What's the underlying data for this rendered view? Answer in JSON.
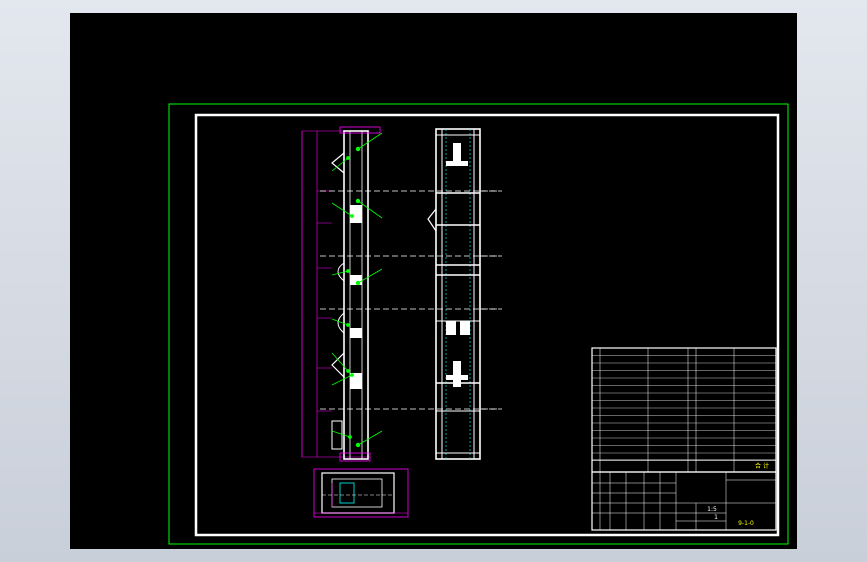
{
  "app": {
    "background": "#d4d9e2",
    "canvas_color": "#000000",
    "sheet_border_color": "#00ff00",
    "frame_color": "#ffffff",
    "dim_color": "#ff00ff",
    "leader_color": "#00ff00",
    "detail_color": "#00ffff"
  },
  "title_block": {
    "drawing_number": "9-1-0",
    "scale_marks": [
      "1:5",
      "1"
    ]
  },
  "parts_list": {
    "header": "合 计"
  }
}
